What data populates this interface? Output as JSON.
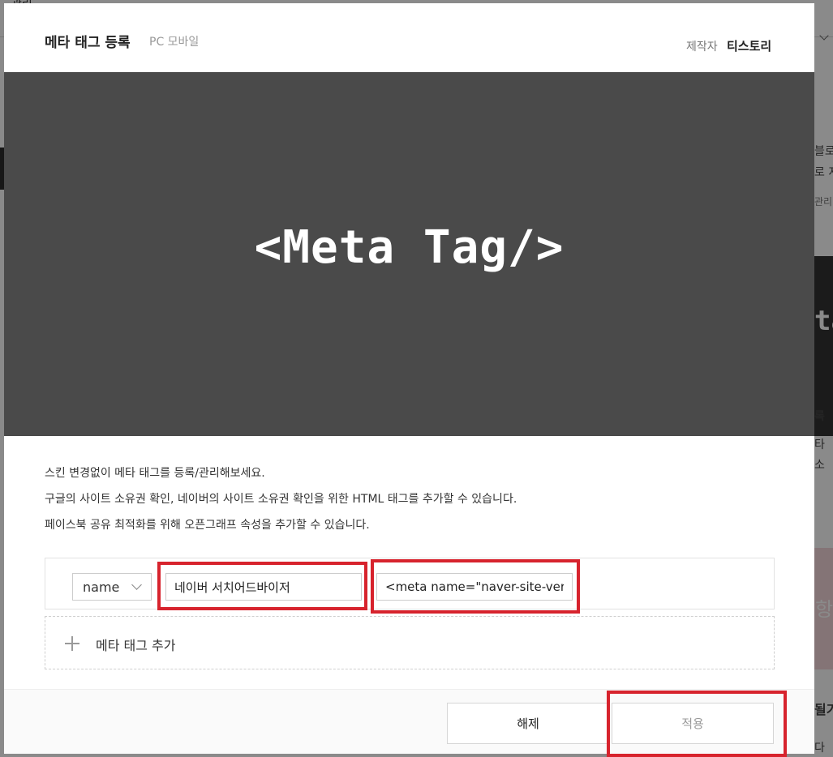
{
  "background": {
    "top_text": "관리",
    "right_texts": [
      "블로",
      "로 저",
      "관리",
      "록",
      "타",
      "소"
    ],
    "right_dark_text": "ta",
    "right_pink_text": "항",
    "right_bottom_text": "될기",
    "right_bottom_text2": "다"
  },
  "modal": {
    "title": "메타 태그 등록",
    "subtitle": "PC 모바일",
    "maker_label": "제작자",
    "maker_name": "티스토리",
    "hero_text": "<Meta Tag/>",
    "description": [
      "스킨 변경없이 메타 태그를 등록/관리해보세요.",
      "구글의 사이트 소유권 확인, 네이버의 사이트 소유권 확인을 위한 HTML 태그를 추가할 수 있습니다.",
      "페이스북 공유 최적화를 위해 오픈그래프 속성을 추가할 수 있습니다."
    ],
    "tag_row": {
      "attribute_select": "name",
      "name_value": "네이버 서치어드바이저",
      "content_value": "<meta name=\"naver-site-verif"
    },
    "add_tag_label": "메타 태그 추가",
    "buttons": {
      "release": "해제",
      "apply": "적용"
    }
  },
  "colors": {
    "highlight": "#d7232d",
    "hero_bg": "#4a4a4a"
  }
}
